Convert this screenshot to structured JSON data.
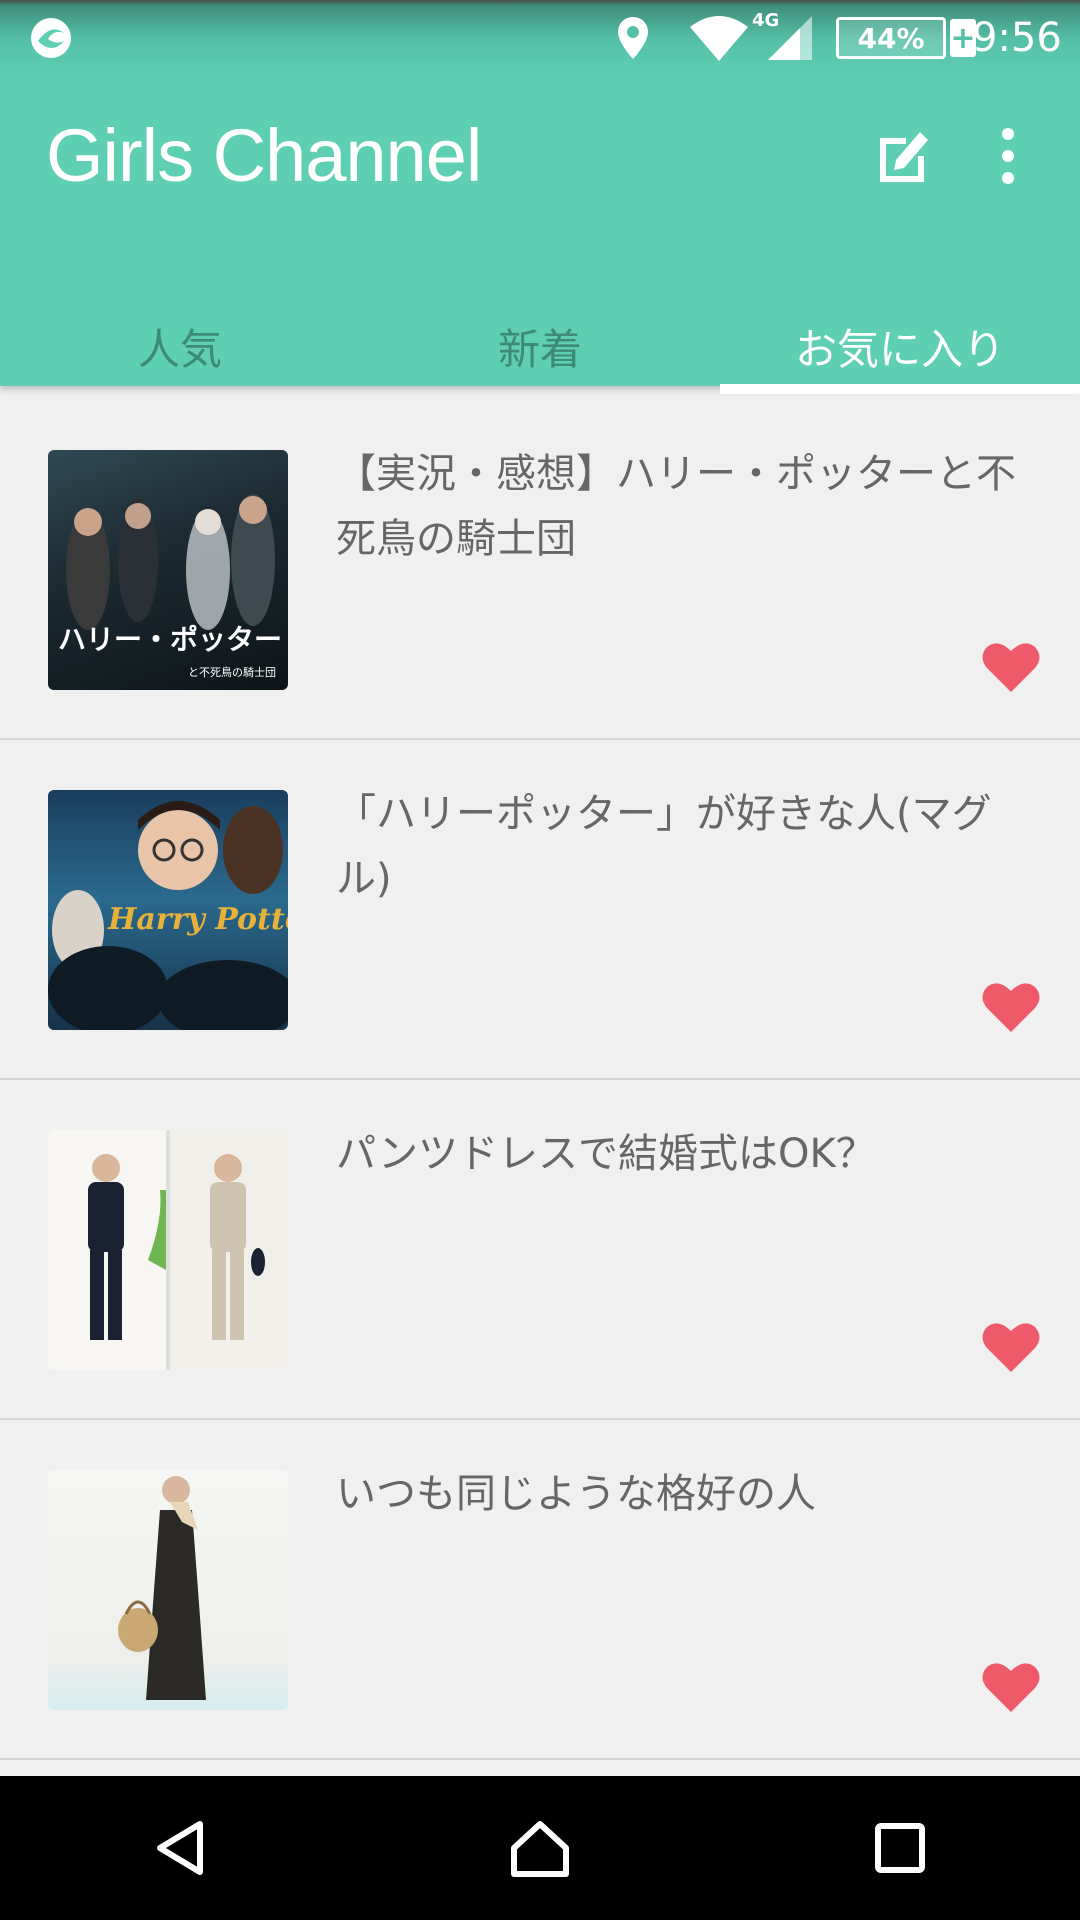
{
  "status_bar": {
    "network": "4G",
    "battery": "44%",
    "time": "9:56"
  },
  "app": {
    "title": "Girls Channel"
  },
  "tabs": [
    {
      "label": "人気",
      "active": false
    },
    {
      "label": "新着",
      "active": false
    },
    {
      "label": "お気に入り",
      "active": true
    }
  ],
  "items": [
    {
      "title": "【実況・感想】ハリー・ポッターと不死鳥の騎士団",
      "favorited": true,
      "thumb_text": "ハリー・ポッター",
      "thumb_subtext": "と不死鳥の騎士団"
    },
    {
      "title": "「ハリーポッター」が好きな人(マグル)",
      "favorited": true,
      "thumb_text": "Harry Potter"
    },
    {
      "title": "パンツドレスで結婚式はOK？",
      "favorited": true
    },
    {
      "title": "いつも同じような格好の人",
      "favorited": true
    }
  ],
  "colors": {
    "accent": "#5ecfb3",
    "heart": "#ee5a6a",
    "tab_inactive": "#3e8a79"
  },
  "icons": [
    "app-notification-icon",
    "location-icon",
    "wifi-icon",
    "signal-icon",
    "battery-icon",
    "compose-icon",
    "more-vert-icon",
    "heart-icon",
    "back-icon",
    "home-icon",
    "recents-icon"
  ]
}
